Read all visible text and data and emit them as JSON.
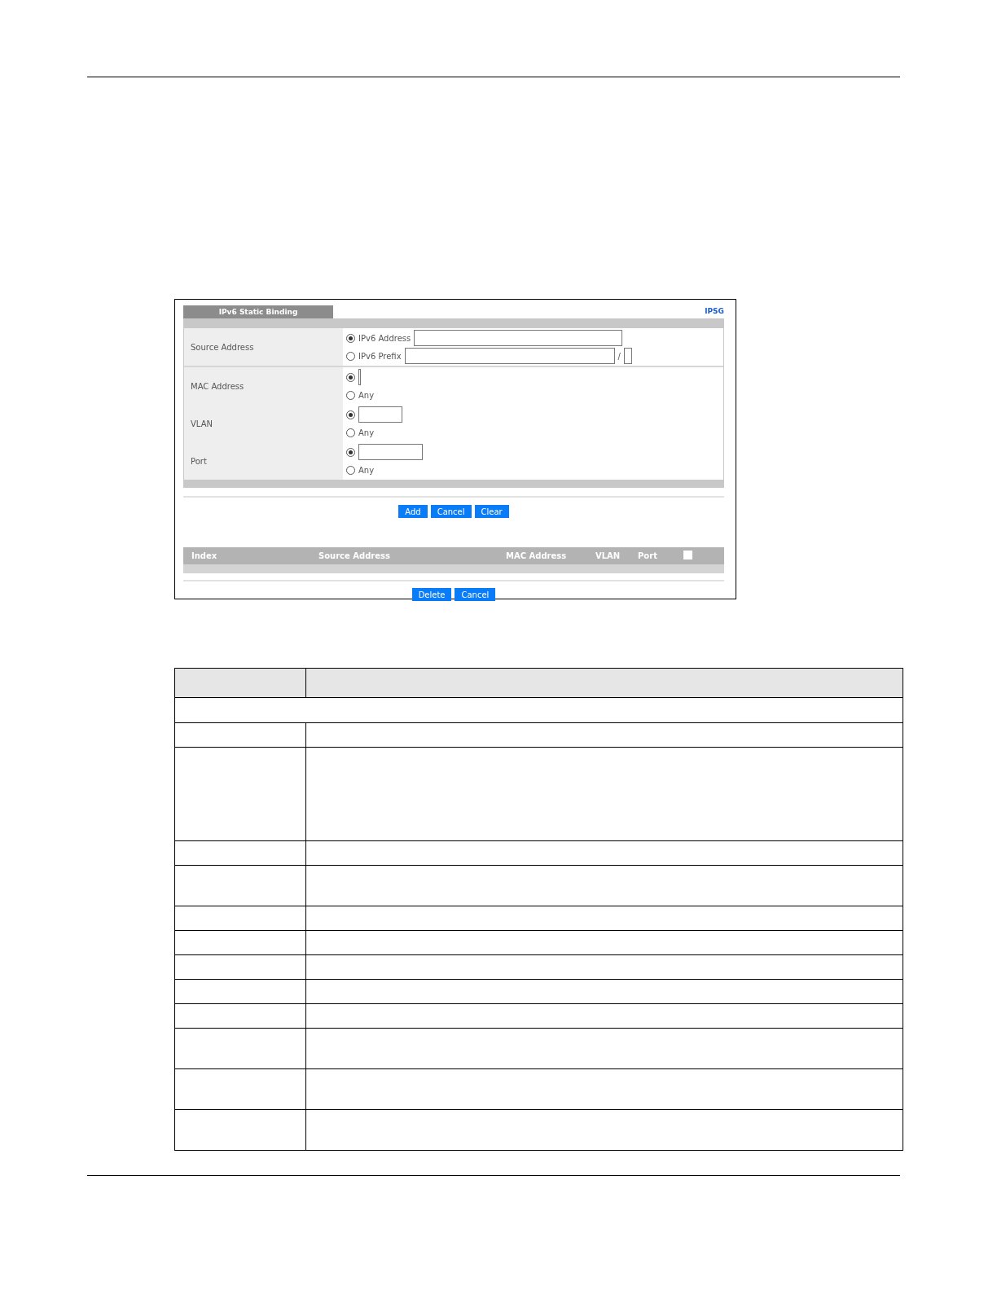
{
  "panel": {
    "tab": "IPv6 Static Binding",
    "link": "IPSG",
    "fields": [
      {
        "label": "Source Address",
        "options": [
          {
            "kind": "address",
            "label": "IPv6 Address",
            "selected": true
          },
          {
            "kind": "prefix",
            "label": "IPv6 Prefix",
            "separator": "/",
            "selected": false
          }
        ]
      },
      {
        "label": "MAC Address",
        "options": [
          {
            "kind": "cursor",
            "selected": true
          },
          {
            "kind": "any",
            "label": "Any",
            "selected": false
          }
        ]
      },
      {
        "label": "VLAN",
        "options": [
          {
            "kind": "short",
            "selected": true
          },
          {
            "kind": "any",
            "label": "Any",
            "selected": false
          }
        ]
      },
      {
        "label": "Port",
        "options": [
          {
            "kind": "medium",
            "selected": true
          },
          {
            "kind": "any",
            "label": "Any",
            "selected": false
          }
        ]
      }
    ],
    "buttons": [
      "Add",
      "Cancel",
      "Clear"
    ],
    "table": {
      "columns": [
        "Index",
        "Source Address",
        "MAC Address",
        "VLAN",
        "Port"
      ],
      "select_all": {
        "checked": false
      }
    },
    "table_buttons": [
      "Delete",
      "Cancel"
    ]
  },
  "description_table": {
    "rows": [
      {
        "kind": "header"
      },
      {
        "kind": "section"
      },
      {
        "kind": "single"
      },
      {
        "kind": "tall"
      },
      {
        "kind": "single"
      },
      {
        "kind": "double"
      },
      {
        "kind": "single"
      },
      {
        "kind": "single"
      },
      {
        "kind": "single"
      },
      {
        "kind": "single"
      },
      {
        "kind": "single"
      },
      {
        "kind": "double"
      },
      {
        "kind": "double"
      },
      {
        "kind": "double"
      }
    ]
  }
}
